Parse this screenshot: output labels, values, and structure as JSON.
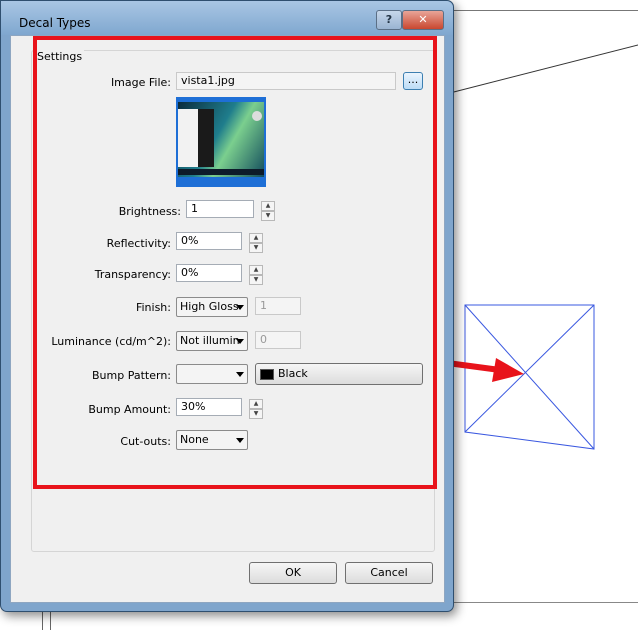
{
  "dialog": {
    "title": "Decal Types",
    "help_label": "?",
    "close_label": "✕"
  },
  "settings": {
    "group_label": "Settings",
    "image_file_label": "Image File:",
    "image_file_value": "vista1.jpg",
    "browse_label": "...",
    "brightness_label": "Brightness:",
    "brightness_value": "1",
    "reflectivity_label": "Reflectivity:",
    "reflectivity_value": "0%",
    "transparency_label": "Transparency:",
    "transparency_value": "0%",
    "finish_label": "Finish:",
    "finish_value": "High Gloss",
    "finish_number": "1",
    "luminance_label": "Luminance (cd/m^2):",
    "luminance_value": "Not illumin",
    "luminance_number": "0",
    "bump_pattern_label": "Bump Pattern:",
    "bump_pattern_value": "",
    "bump_color_label": "Black",
    "bump_amount_label": "Bump Amount:",
    "bump_amount_value": "30%",
    "cutouts_label": "Cut-outs:",
    "cutouts_value": "None"
  },
  "buttons": {
    "ok": "OK",
    "cancel": "Cancel"
  },
  "colors": {
    "highlight": "#e8131b",
    "arrow": "#e8131b",
    "decal_outline": "#3a58e0",
    "bump_swatch": "#000000"
  }
}
